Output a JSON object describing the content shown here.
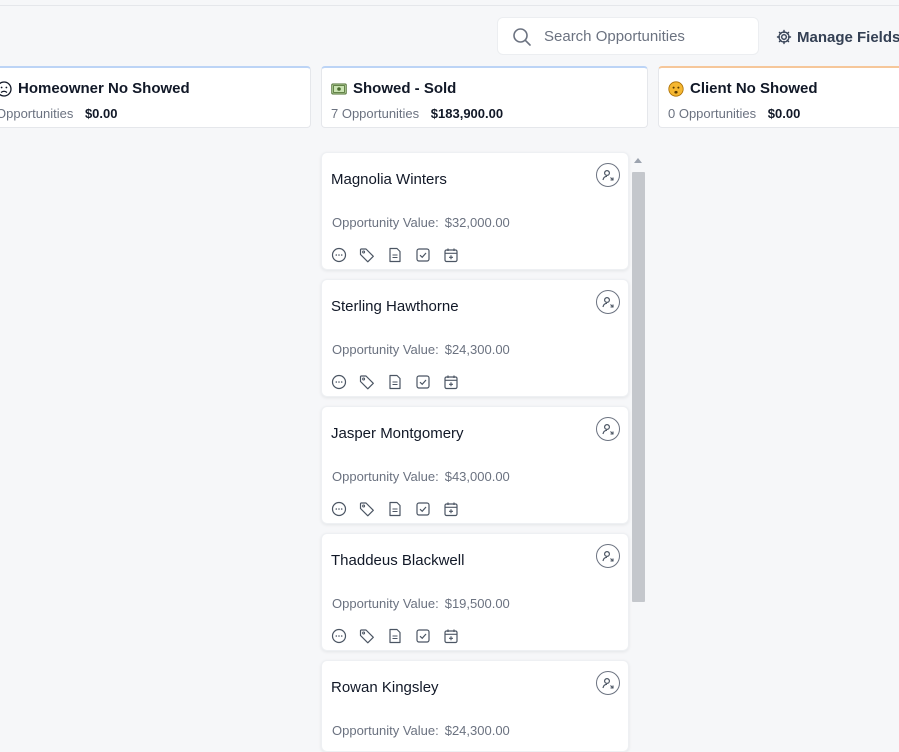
{
  "search": {
    "placeholder": "Search Opportunities"
  },
  "toolbar": {
    "manage_fields_label": "Manage Fields"
  },
  "columns": [
    {
      "title": "Homeowner No Showed",
      "count": "Opportunities",
      "amount": "$0.00"
    },
    {
      "title": "Showed - Sold",
      "count": "7 Opportunities",
      "amount": "$183,900.00"
    },
    {
      "title": "Client No Showed",
      "count": "0 Opportunities",
      "amount": "$0.00"
    }
  ],
  "card_value_label": "Opportunity Value:",
  "cards": [
    {
      "name": "Magnolia Winters",
      "value": "$32,000.00"
    },
    {
      "name": "Sterling Hawthorne",
      "value": "$24,300.00"
    },
    {
      "name": "Jasper Montgomery",
      "value": "$43,000.00"
    },
    {
      "name": "Thaddeus Blackwell",
      "value": "$19,500.00"
    },
    {
      "name": "Rowan Kingsley",
      "value": "$24,300.00"
    }
  ],
  "card_action_icons": [
    "chat-icon",
    "tag-icon",
    "note-icon",
    "task-icon",
    "calendar-icon"
  ]
}
